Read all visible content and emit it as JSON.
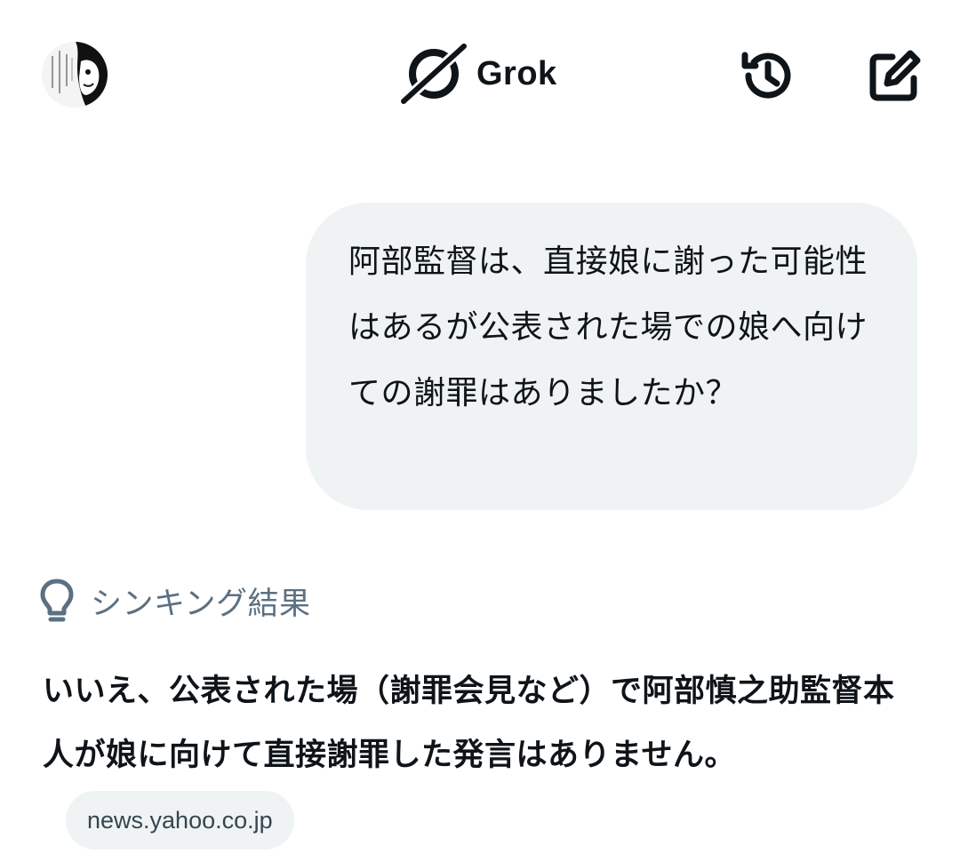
{
  "header": {
    "avatar_icon": "user-avatar-manga",
    "brand_name": "Grok",
    "brand_icon": "grok-logo-icon",
    "history_icon": "history-icon",
    "new_chat_icon": "compose-icon"
  },
  "conversation": {
    "user_message": "阿部監督は、直接娘に謝った可能性はあるが公表された場での娘へ向けての謝罪はありましたか？",
    "thinking_label": "シンキング結果",
    "answer_text": "いいえ、公表された場（謝罪会見など）で阿部慎之助監督本人が娘に向けて直接謝罪した発言はありません。",
    "source_chip": "news.yahoo.co.jp"
  },
  "colors": {
    "bubble_bg": "#eff3f4",
    "text_primary": "#0f1419",
    "text_secondary": "#5b7083"
  }
}
